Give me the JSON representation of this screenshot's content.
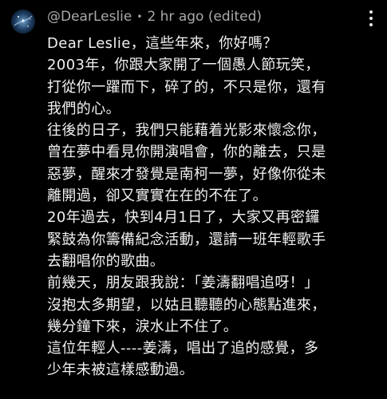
{
  "comment": {
    "author": "@DearLeslie",
    "separator": "•",
    "timestamp": "2 hr ago (edited)",
    "avatar_icon": "space-galaxy-avatar",
    "more_icon": "more-vertical-icon",
    "lines": [
      "Dear Leslie，這些年來，你好嗎？",
      "2003年，你跟大家開了一個愚人節玩笑，",
      "打從你一躍而下，碎了的，不只是你，還有",
      "我們的心。",
      "往後的日子，我們只能藉着光影來懷念你，",
      "曾在夢中看見你開演唱會，你的離去，只是",
      "惡夢，醒來才發覺是南柯一夢，好像你從未",
      "離開過，卻又實實在在的不在了。",
      "20年過去，快到4月1日了，大家又再密鑼",
      "緊鼓為你籌備紀念活動，還請一班年輕歌手",
      "去翻唱你的歌曲。",
      "前幾天，朋友跟我說：「姜濤翻唱追呀！」",
      "沒抱太多期望，以姑且聽聽的心態點進來，",
      "幾分鐘下來，淚水止不住了。",
      "這位年輕人----姜濤，唱出了追的感覺，多",
      "少年未被這樣感動過。"
    ]
  },
  "colors": {
    "background": "#000000",
    "text": "#f1f1f1",
    "meta": "#aaaaaa"
  }
}
